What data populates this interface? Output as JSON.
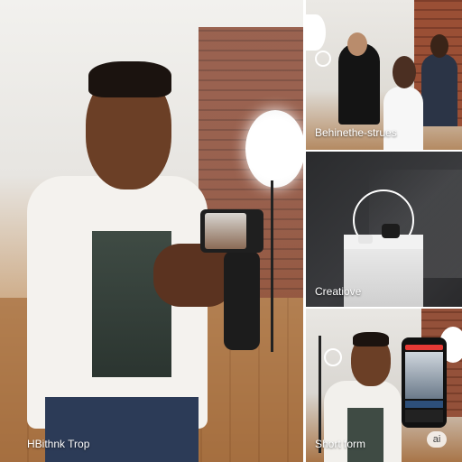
{
  "tiles": {
    "main": {
      "caption": "HBithnk Trop"
    },
    "top_right": {
      "caption": "Behinethe-strues"
    },
    "middle_right": {
      "caption": "Creatiove"
    },
    "bottom_right": {
      "caption": "Short form",
      "badge": "ai"
    }
  }
}
